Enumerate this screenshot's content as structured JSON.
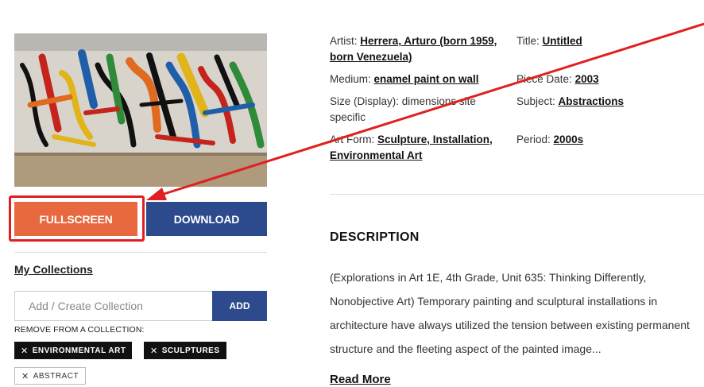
{
  "actions": {
    "fullscreen_label": "FULLSCREEN",
    "download_label": "DOWNLOAD"
  },
  "collections": {
    "title": "My Collections",
    "input_placeholder": "Add / Create Collection",
    "add_label": "ADD",
    "remove_label": "REMOVE FROM A COLLECTION:",
    "tags": [
      {
        "label": "ENVIRONMENTAL ART",
        "style": "dark"
      },
      {
        "label": "SCULPTURES",
        "style": "dark"
      },
      {
        "label": "ABSTRACT",
        "style": "light"
      }
    ],
    "tag_remove_glyph": "✕"
  },
  "metadata": {
    "artist": {
      "label": "Artist:",
      "value": "Herrera, Arturo (born 1959, born Venezuela)"
    },
    "title": {
      "label": "Title:",
      "value": "Untitled"
    },
    "medium": {
      "label": "Medium:",
      "value": "enamel paint on wall"
    },
    "piece_date": {
      "label": "Piece Date:",
      "value": "2003"
    },
    "size": {
      "label": "Size (Display):",
      "value": "dimensions site specific"
    },
    "subject": {
      "label": "Subject:",
      "value": "Abstractions"
    },
    "art_form": {
      "label": "Art Form:",
      "value": "Sculpture, Installation, Environmental Art"
    },
    "period": {
      "label": "Period:",
      "value": "2000s"
    }
  },
  "description": {
    "heading": "DESCRIPTION",
    "text": "(Explorations in Art 1E, 4th Grade, Unit 635: Thinking Differently, Nonobjective Art) Temporary painting and sculptural installations in architecture have always utilized the tension between existing permanent structure and the fleeting aspect of the painted image...",
    "read_more": "Read More"
  },
  "annotation": {
    "highlight_color": "#e02020",
    "target": "fullscreen-button"
  },
  "colors": {
    "fullscreen": "#e8693f",
    "download": "#2c4a8c",
    "tag_dark": "#111111"
  }
}
